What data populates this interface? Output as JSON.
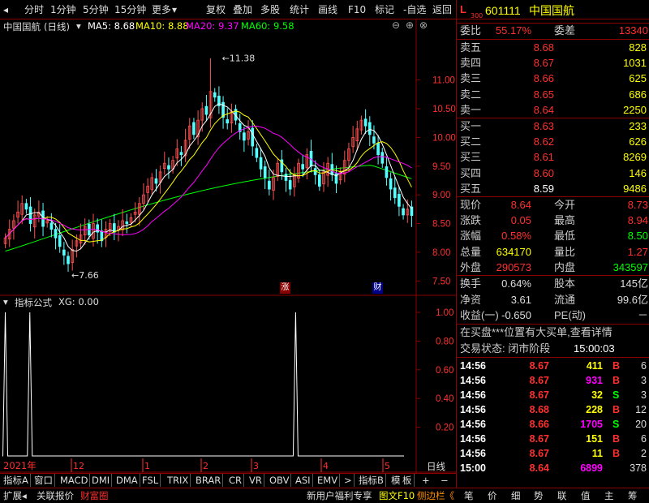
{
  "toolbar": {
    "left_tabs": [
      "分时",
      "1分钟",
      "5分钟",
      "15分钟",
      "更多"
    ],
    "right_tabs": [
      "复权",
      "叠加",
      "多股",
      "统计",
      "画线",
      "F10",
      "标记",
      "-自选",
      "返回"
    ]
  },
  "chart_header": {
    "name": "中国国航",
    "period": "(日线)",
    "ma5_label": "MA5: 8.68",
    "ma10_label": "MA10: 8.88",
    "ma20_label": "MA20: 9.37",
    "ma60_label": "MA60: 9.58"
  },
  "colors": {
    "ma5": "#ffffff",
    "ma10": "#ffff00",
    "ma20": "#ff00ff",
    "ma60": "#00ff00",
    "up": "#ff5050",
    "down": "#54ffff",
    "grid": "#8b0000",
    "accent_red": "#ff3030",
    "volume_yellow": "#dddd00"
  },
  "price_annotations": {
    "high": "11.38",
    "low": "7.66"
  },
  "markers": {
    "zhang": "涨",
    "cai": "财"
  },
  "x_axis": {
    "year_label": "2021年",
    "months": [
      "12",
      "1",
      "2",
      "3",
      "4",
      "5"
    ],
    "period_label": "日线"
  },
  "indicator": {
    "title": "指标公式",
    "value_label": "XG: 0.00",
    "y_ticks": [
      "1.00",
      "0.80",
      "0.60",
      "0.40",
      "0.20"
    ],
    "spikes": [
      {
        "index": 0,
        "value": 1
      },
      {
        "index": 6,
        "value": 1
      },
      {
        "index": 71,
        "value": 1
      }
    ]
  },
  "chart_data": {
    "type": "candlestick",
    "y_axis_ticks": [
      "11.00",
      "10.50",
      "10.00",
      "9.50",
      "9.00",
      "8.50",
      "8.00",
      "7.50"
    ],
    "ylim": [
      7.25,
      11.8
    ],
    "high": 11.38,
    "low": 7.66,
    "closes": [
      8.25,
      8.4,
      8.55,
      8.7,
      8.85,
      8.75,
      8.5,
      8.65,
      8.7,
      8.45,
      8.55,
      8.4,
      8.25,
      8.1,
      7.95,
      7.8,
      8.05,
      8.2,
      8.3,
      8.45,
      8.3,
      8.5,
      8.35,
      8.2,
      8.4,
      8.5,
      8.35,
      8.45,
      8.55,
      8.5,
      8.6,
      8.7,
      8.85,
      9.0,
      9.15,
      9.3,
      9.2,
      9.4,
      9.55,
      9.45,
      9.6,
      9.8,
      9.7,
      9.95,
      10.2,
      10.05,
      10.3,
      10.5,
      10.4,
      10.8,
      10.7,
      10.55,
      10.35,
      10.25,
      10.45,
      10.3,
      10.1,
      9.95,
      10.1,
      9.85,
      9.65,
      9.45,
      9.3,
      9.1,
      9.3,
      9.55,
      9.4,
      9.25,
      9.1,
      9.35,
      9.55,
      9.45,
      9.7,
      9.5,
      9.35,
      9.15,
      9.4,
      9.55,
      9.35,
      9.2,
      9.4,
      9.6,
      9.8,
      10.0,
      10.15,
      10.3,
      10.2,
      10.05,
      9.9,
      9.7,
      9.55,
      9.3,
      9.1,
      8.95,
      8.8,
      8.65,
      8.75,
      8.64
    ],
    "ma60_start": 8.02,
    "ma60_end": 9.58
  },
  "stock": {
    "code_prefix": "L",
    "code_sub": "300",
    "code": "601111",
    "name": "中国国航"
  },
  "wei": {
    "label1": "委比",
    "value1": "55.17%",
    "label2": "委差",
    "value2": "13340"
  },
  "sell_orders": [
    {
      "label": "卖五",
      "price": "8.68",
      "volume": "828"
    },
    {
      "label": "卖四",
      "price": "8.67",
      "volume": "1031"
    },
    {
      "label": "卖三",
      "price": "8.66",
      "volume": "625"
    },
    {
      "label": "卖二",
      "price": "8.65",
      "volume": "686"
    },
    {
      "label": "卖一",
      "price": "8.64",
      "volume": "2250"
    }
  ],
  "buy_orders": [
    {
      "label": "买一",
      "price": "8.63",
      "volume": "233"
    },
    {
      "label": "买二",
      "price": "8.62",
      "volume": "626"
    },
    {
      "label": "买三",
      "price": "8.61",
      "volume": "8269"
    },
    {
      "label": "买四",
      "price": "8.60",
      "volume": "146"
    },
    {
      "label": "买五",
      "price": "8.59",
      "volume": "9486"
    }
  ],
  "quote_stats": [
    {
      "l1": "现价",
      "v1": "8.64",
      "l2": "今开",
      "v2": "8.73"
    },
    {
      "l1": "涨跌",
      "v1": "0.05",
      "l2": "最高",
      "v2": "8.94"
    },
    {
      "l1": "涨幅",
      "v1": "0.58%",
      "l2": "最低",
      "v2": "8.50"
    },
    {
      "l1": "总量",
      "v1": "634170",
      "l2": "量比",
      "v2": "1.27"
    },
    {
      "l1": "外盘",
      "v1": "290573",
      "l2": "内盘",
      "v2": "343597"
    }
  ],
  "fundamental_stats": [
    {
      "l1": "换手",
      "v1": "0.64%",
      "l2": "股本",
      "v2": "145亿"
    },
    {
      "l1": "净资",
      "v1": "3.61",
      "l2": "流通",
      "v2": "99.6亿"
    },
    {
      "l1": "收益(一)",
      "v1": "-0.650",
      "l2": "PE(动)",
      "v2": "－"
    }
  ],
  "notice": "在买盘***位置有大买单,查看详情",
  "trade_status": {
    "label": "交易状态: 闭市阶段",
    "time": "15:00:03"
  },
  "ticks": [
    {
      "time": "14:56",
      "price": "8.67",
      "volume": "411",
      "side": "B",
      "count": "6"
    },
    {
      "time": "14:56",
      "price": "8.67",
      "volume": "931",
      "side": "B",
      "count": "3"
    },
    {
      "time": "14:56",
      "price": "8.67",
      "volume": "32",
      "side": "S",
      "count": "3"
    },
    {
      "time": "14:56",
      "price": "8.68",
      "volume": "228",
      "side": "B",
      "count": "12"
    },
    {
      "time": "14:56",
      "price": "8.66",
      "volume": "1705",
      "side": "S",
      "count": "20"
    },
    {
      "time": "14:56",
      "price": "8.67",
      "volume": "151",
      "side": "B",
      "count": "6"
    },
    {
      "time": "14:56",
      "price": "8.67",
      "volume": "11",
      "side": "B",
      "count": "2"
    },
    {
      "time": "15:00",
      "price": "8.64",
      "volume": "6899",
      "side": "",
      "count": "378"
    }
  ],
  "bottom_tabs": [
    "指标A",
    "窗口",
    "MACD",
    "DMI",
    "DMA",
    "FSL",
    "TRIX",
    "BRAR",
    "CR",
    "VR",
    "OBV",
    "ASI",
    "EMV",
    ">"
  ],
  "bottom_right_tabs": [
    "指标B",
    "模",
    "板",
    "+",
    "−"
  ],
  "status_bar": {
    "left": [
      "扩展◂",
      "关联报价",
      "财富圈"
    ],
    "mid": [
      "新用户福利专享",
      "图文F10",
      "侧边栏《"
    ],
    "right": [
      "笔",
      "价",
      "细",
      "势",
      "联",
      "值",
      "主",
      "筹"
    ]
  }
}
